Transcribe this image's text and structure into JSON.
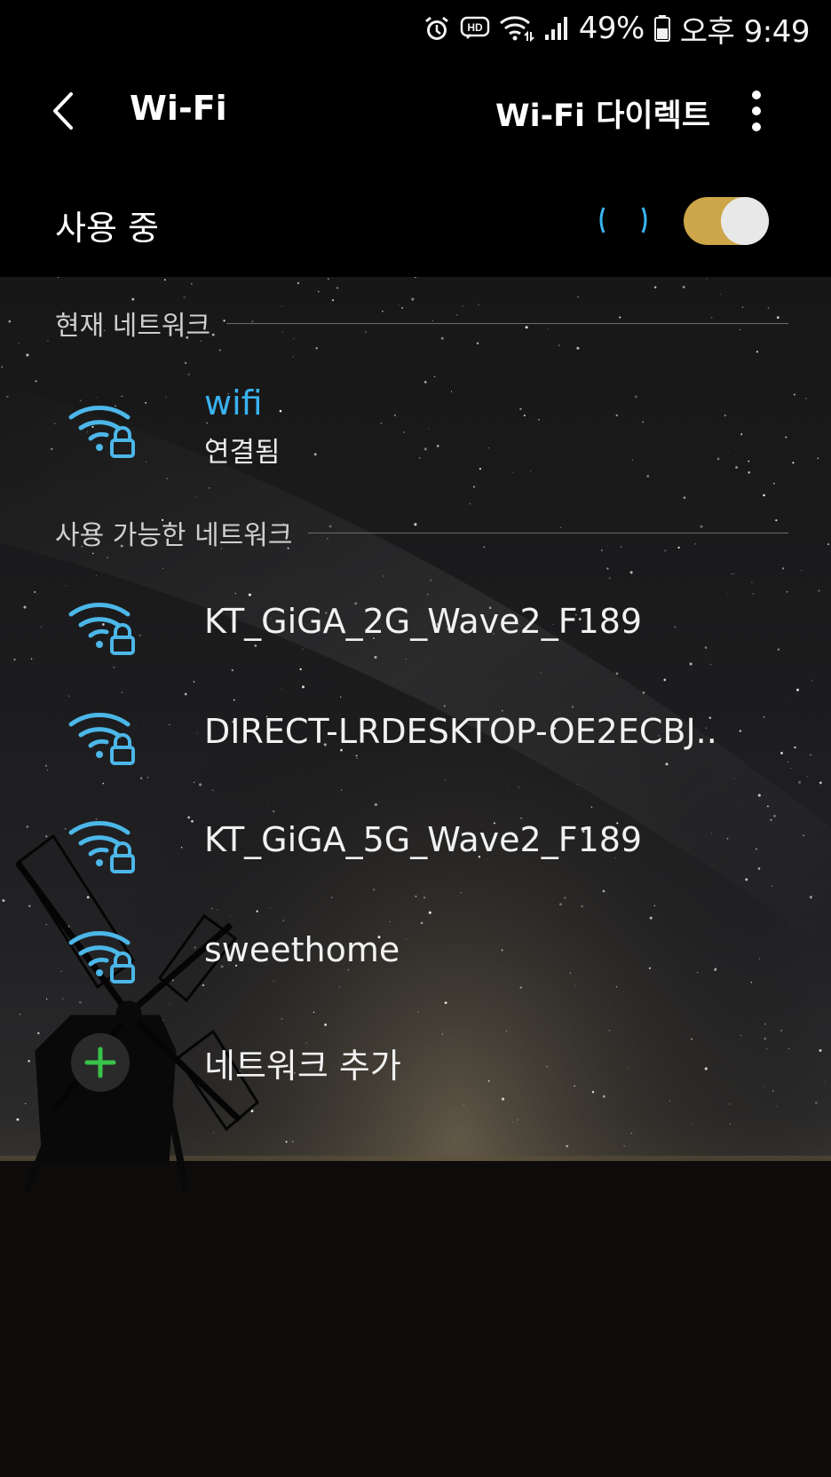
{
  "status_bar": {
    "icons": [
      "alarm-icon",
      "hd-voice-icon",
      "wifi-data-icon",
      "signal-icon",
      "battery-icon"
    ],
    "battery": "49%",
    "time": "오후 9:49"
  },
  "app_bar": {
    "title": "Wi-Fi",
    "direct_label": "Wi-Fi 다이렉트",
    "icons": [
      "back-icon",
      "more-vert-icon"
    ]
  },
  "master_switch": {
    "label": "사용 중",
    "enabled": true,
    "toggle_color": "#cda649"
  },
  "current_section": {
    "header": "현재 네트워크",
    "network": {
      "name": "wifi",
      "status": "연결됨",
      "name_color": "#3ab3f0"
    }
  },
  "available_section": {
    "header": "사용 가능한 네트워크",
    "networks": [
      {
        "name": "KT_GiGA_2G_Wave2_F189",
        "secured": true
      },
      {
        "name": "DIRECT-LRDESKTOP-OE2ECBJ..",
        "secured": true
      },
      {
        "name": "KT_GiGA_5G_Wave2_F189",
        "secured": true
      },
      {
        "name": "sweethome",
        "secured": true
      }
    ],
    "add_network_label": "네트워크 추가"
  },
  "colors": {
    "icon_blue": "#4cb7e8",
    "add_green": "#39c24a"
  }
}
